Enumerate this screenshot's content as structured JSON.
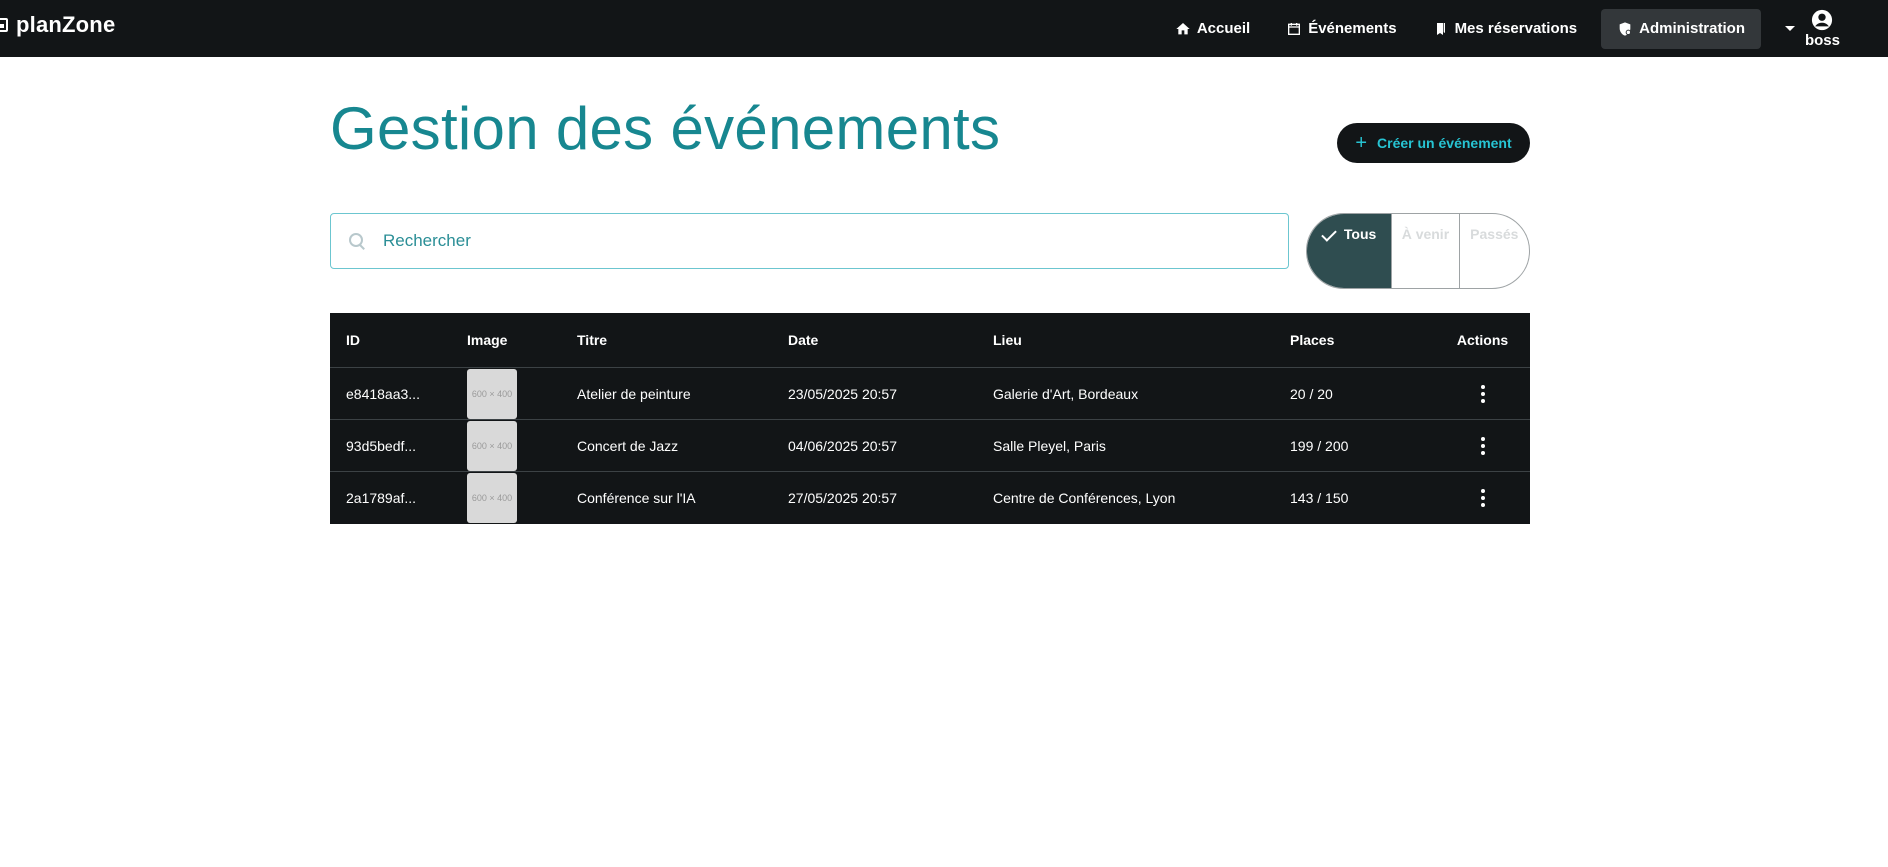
{
  "app": {
    "title": "planZone"
  },
  "nav": {
    "home": "Accueil",
    "events": "Événements",
    "bookings": "Mes réservations",
    "admin": "Administration",
    "user": "boss"
  },
  "page": {
    "title": "Gestion des événements",
    "create_button": "Créer un événement"
  },
  "search": {
    "placeholder": "Rechercher"
  },
  "filters": {
    "all": "Tous",
    "upcoming": "À venir",
    "past": "Passés",
    "selected": "Tous"
  },
  "table": {
    "headers": {
      "id": "ID",
      "image": "Image",
      "title": "Titre",
      "date": "Date",
      "place": "Lieu",
      "seats": "Places",
      "actions": "Actions"
    },
    "rows": [
      {
        "id": "e8418aa3...",
        "image": "600 × 400",
        "title": "Atelier de peinture",
        "date": "23/05/2025 20:57",
        "place": "Galerie d'Art, Bordeaux",
        "seats": "20 / 20"
      },
      {
        "id": "93d5bedf...",
        "image": "600 × 400",
        "title": "Concert de Jazz",
        "date": "04/06/2025 20:57",
        "place": "Salle Pleyel, Paris",
        "seats": "199 / 200"
      },
      {
        "id": "2a1789af...",
        "image": "600 × 400",
        "title": "Conférence sur l'IA",
        "date": "27/05/2025 20:57",
        "place": "Centre de Conférences, Lyon",
        "seats": "143 / 150"
      }
    ]
  },
  "colors": {
    "topbar": "#121517",
    "accent": "#178790",
    "create_text": "#27c4d3",
    "filter_selected": "#2f4d50"
  },
  "icons": {
    "home": "home-icon",
    "events": "calendar-icon",
    "bookings": "bookmark-icon",
    "admin": "shield-icon",
    "user": "account-circle-icon",
    "search": "search-icon",
    "actions": "more-vert-icon"
  }
}
